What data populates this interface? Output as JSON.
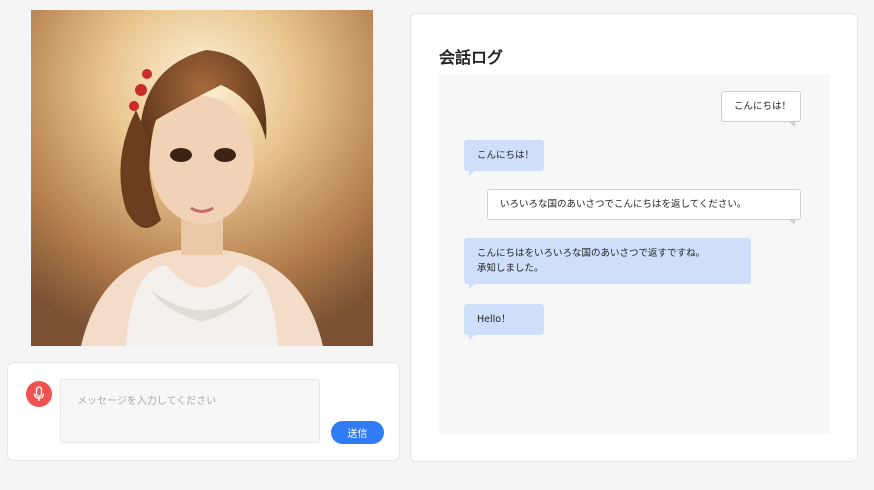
{
  "avatar": {
    "alt": "AI character portrait"
  },
  "composer": {
    "placeholder": "メッセージを入力してください",
    "send_label": "送信",
    "mic_icon": "microphone-icon",
    "mic_color": "#f25151",
    "accent_color": "#2f7cf6"
  },
  "log": {
    "title": "会話ログ",
    "messages": [
      {
        "role": "user",
        "lines": [
          "こんにちは！"
        ]
      },
      {
        "role": "ai",
        "lines": [
          "こんにちは！"
        ]
      },
      {
        "role": "user",
        "lines": [
          "いろいろな国のあいさつでこんにちはを返してください。"
        ]
      },
      {
        "role": "ai",
        "lines": [
          "こんにちはをいろいろな国のあいさつで返すですね。",
          "承知しました。"
        ]
      },
      {
        "role": "ai",
        "lines": [
          "Hello！"
        ]
      }
    ]
  }
}
